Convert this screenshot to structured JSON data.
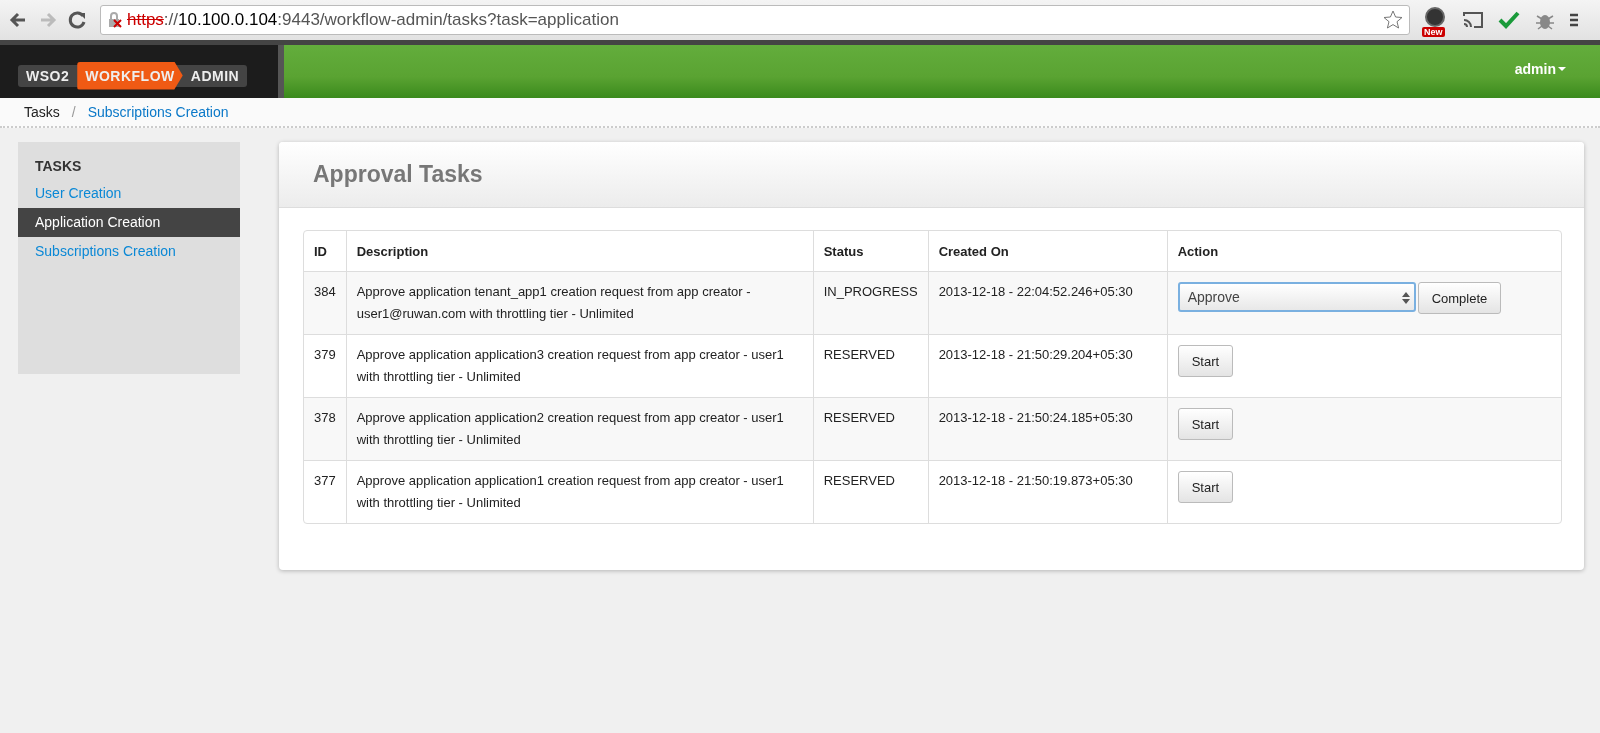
{
  "browser": {
    "url": {
      "scheme": "https",
      "rest_start": "://",
      "host": "10.100.0.104",
      "path": ":9443/workflow-admin/tasks?task=application",
      "insecure": true
    },
    "extension_badge": "New"
  },
  "header": {
    "logo": [
      "WSO2",
      "WORKFLOW",
      "ADMIN"
    ],
    "user": "admin"
  },
  "breadcrumb": [
    {
      "label": "Tasks",
      "link": false
    },
    {
      "label": "/",
      "link": false
    },
    {
      "label": "Subscriptions Creation",
      "link": true
    }
  ],
  "sidebar": {
    "heading": "TASKS",
    "items": [
      {
        "label": "User Creation",
        "selected": false
      },
      {
        "label": "Application Creation",
        "selected": true
      },
      {
        "label": "Subscriptions Creation",
        "selected": false
      }
    ]
  },
  "panel": {
    "title": "Approval Tasks"
  },
  "table": {
    "columns": [
      "ID",
      "Description",
      "Status",
      "Created On",
      "Action"
    ],
    "rows": [
      {
        "id": "384",
        "description": "Approve application tenant_app1 creation request from app creator - user1@ruwan.com with throttling tier - Unlimited",
        "status": "IN_PROGRESS",
        "created_on": "2013-12-18 - 22:04:52.246+05:30",
        "action": {
          "kind": "select",
          "value": "Approve",
          "button": "Complete"
        }
      },
      {
        "id": "379",
        "description": "Approve application application3 creation request from app creator - user1 with throttling tier - Unlimited",
        "status": "RESERVED",
        "created_on": "2013-12-18 - 21:50:29.204+05:30",
        "action": {
          "kind": "start",
          "button": "Start"
        }
      },
      {
        "id": "378",
        "description": "Approve application application2 creation request from app creator - user1 with throttling tier - Unlimited",
        "status": "RESERVED",
        "created_on": "2013-12-18 - 21:50:24.185+05:30",
        "action": {
          "kind": "start",
          "button": "Start"
        }
      },
      {
        "id": "377",
        "description": "Approve application application1 creation request from app creator - user1 with throttling tier - Unlimited",
        "status": "RESERVED",
        "created_on": "2013-12-18 - 21:50:19.873+05:30",
        "action": {
          "kind": "start",
          "button": "Start"
        }
      }
    ]
  }
}
